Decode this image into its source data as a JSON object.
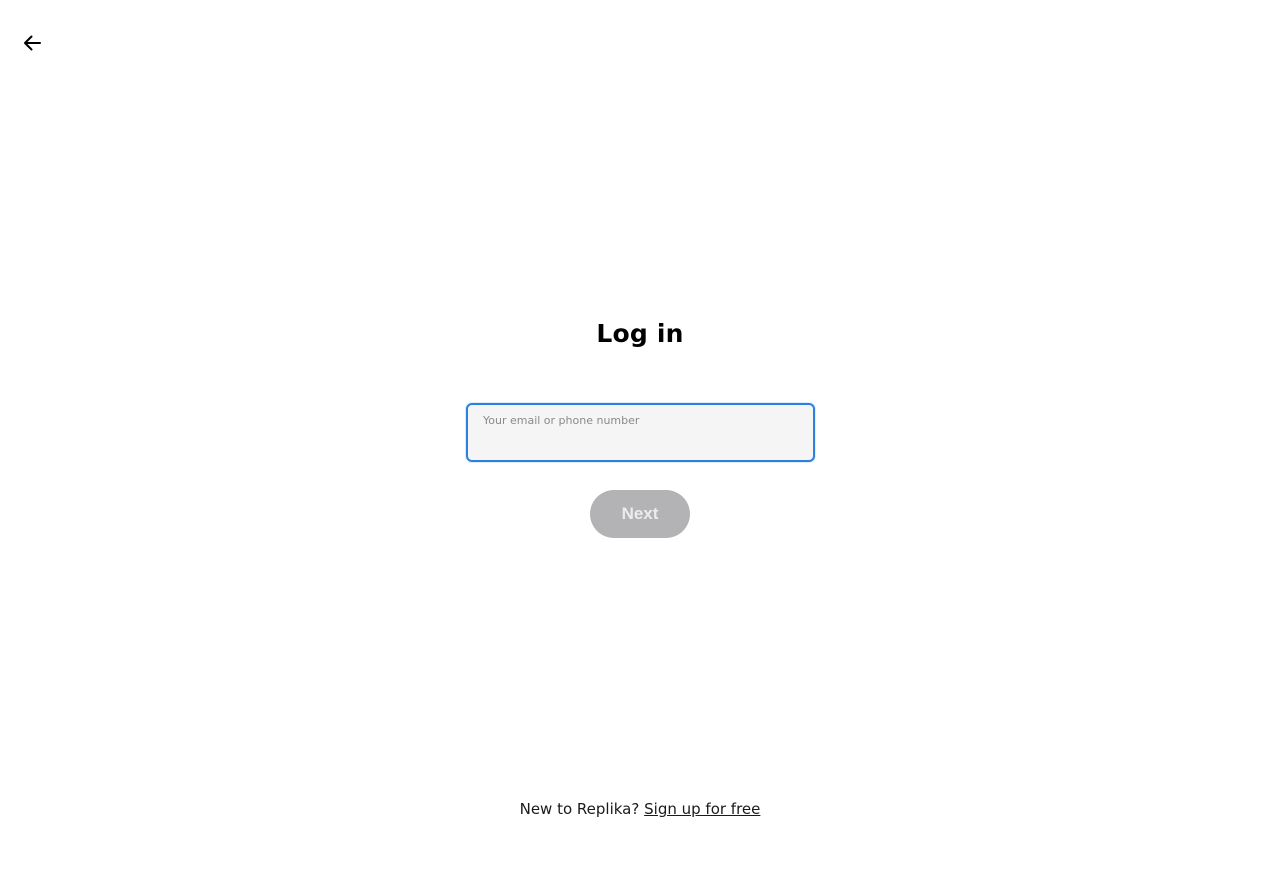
{
  "header": {
    "back_icon": "arrow-left-icon"
  },
  "main": {
    "title": "Log in",
    "login_field": {
      "label": "Your email or phone number",
      "value": ""
    },
    "next_button_label": "Next"
  },
  "footer": {
    "prompt": "New to Replika?",
    "signup_link": "Sign up for free"
  },
  "colors": {
    "field_focus_border": "#2d7fe0",
    "field_background": "#f5f5f5",
    "button_disabled": "#b3b3b5"
  }
}
